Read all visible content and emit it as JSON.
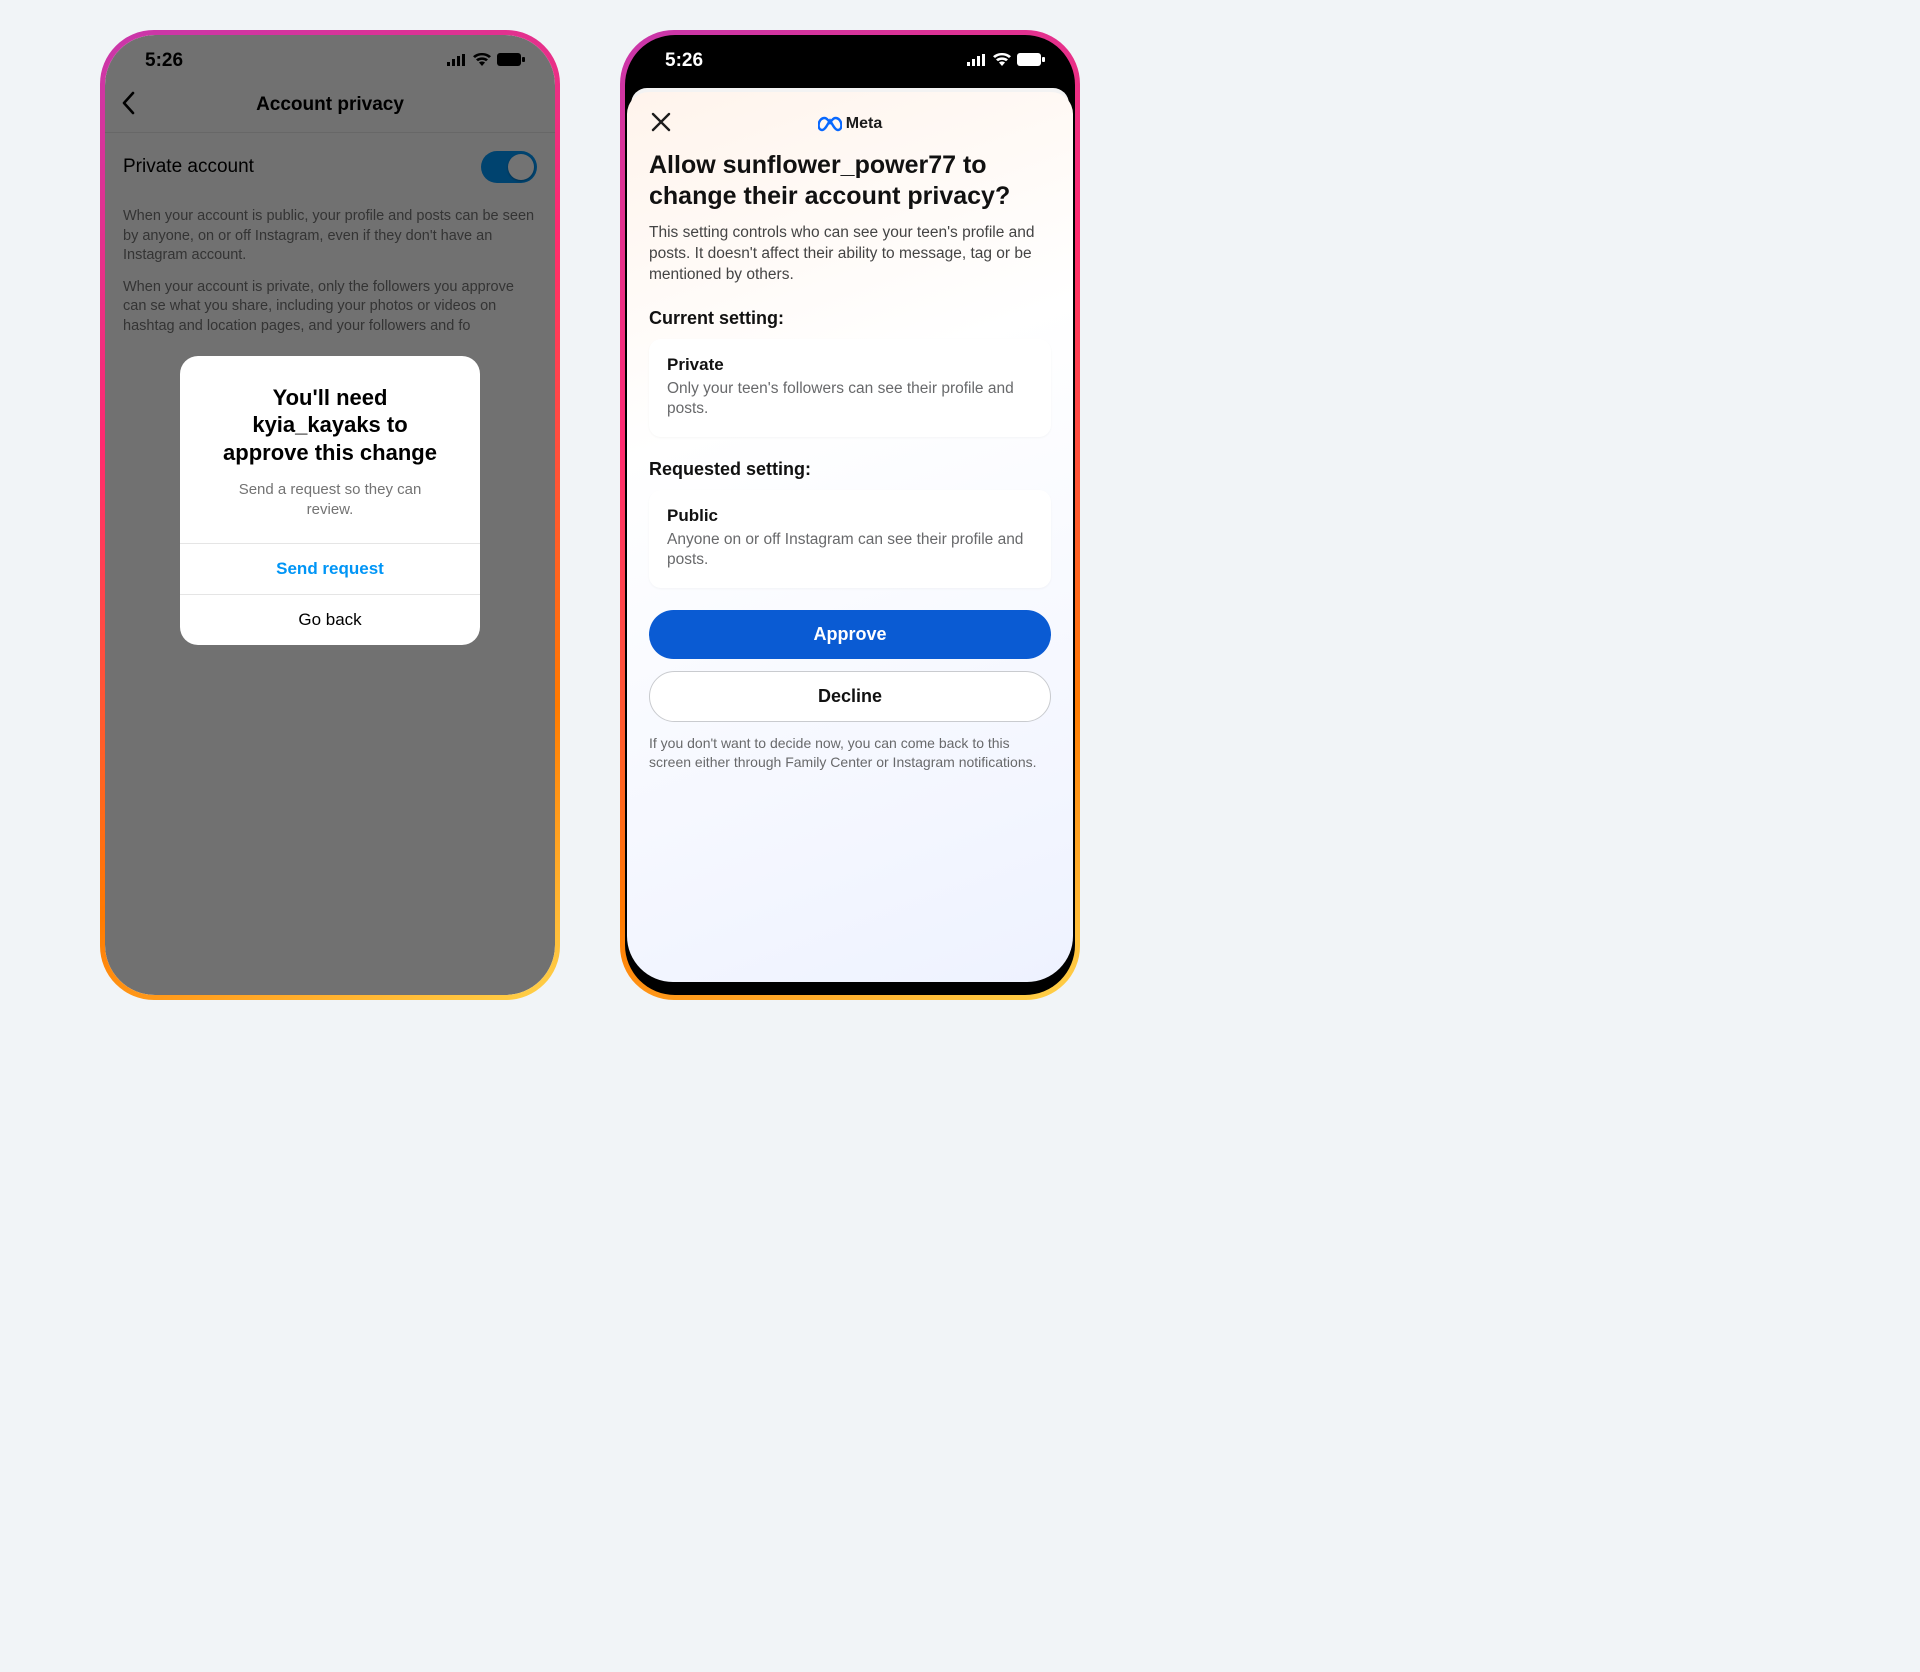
{
  "phone1": {
    "time": "5:26",
    "nav_title": "Account privacy",
    "setting_label": "Private account",
    "desc1": "When your account is public, your profile and posts can be seen by anyone, on or off Instagram, even if they don't have an Instagram account.",
    "desc2": "When your account is private, only the followers you approve can se what you share, including your photos or videos on hashtag and location pages, and your followers and fo",
    "modal": {
      "title": "You'll need kyia_kayaks to approve this change",
      "subtitle": "Send a request so they can review.",
      "primary": "Send request",
      "secondary": "Go back"
    }
  },
  "phone2": {
    "time": "5:26",
    "brand": "Meta",
    "title": "Allow sunflower_power77 to change their account privacy?",
    "subtitle": "This setting controls who can see your teen's profile and posts. It doesn't affect their ability to message, tag or be mentioned by others.",
    "current_label": "Current setting:",
    "current": {
      "title": "Private",
      "desc": "Only your teen's followers can see their profile and posts."
    },
    "requested_label": "Requested setting:",
    "requested": {
      "title": "Public",
      "desc": "Anyone on or off Instagram can see their profile and posts."
    },
    "approve": "Approve",
    "decline": "Decline",
    "footer": "If you don't want to decide now, you can come back to this screen either through Family Center or Instagram notifications."
  }
}
